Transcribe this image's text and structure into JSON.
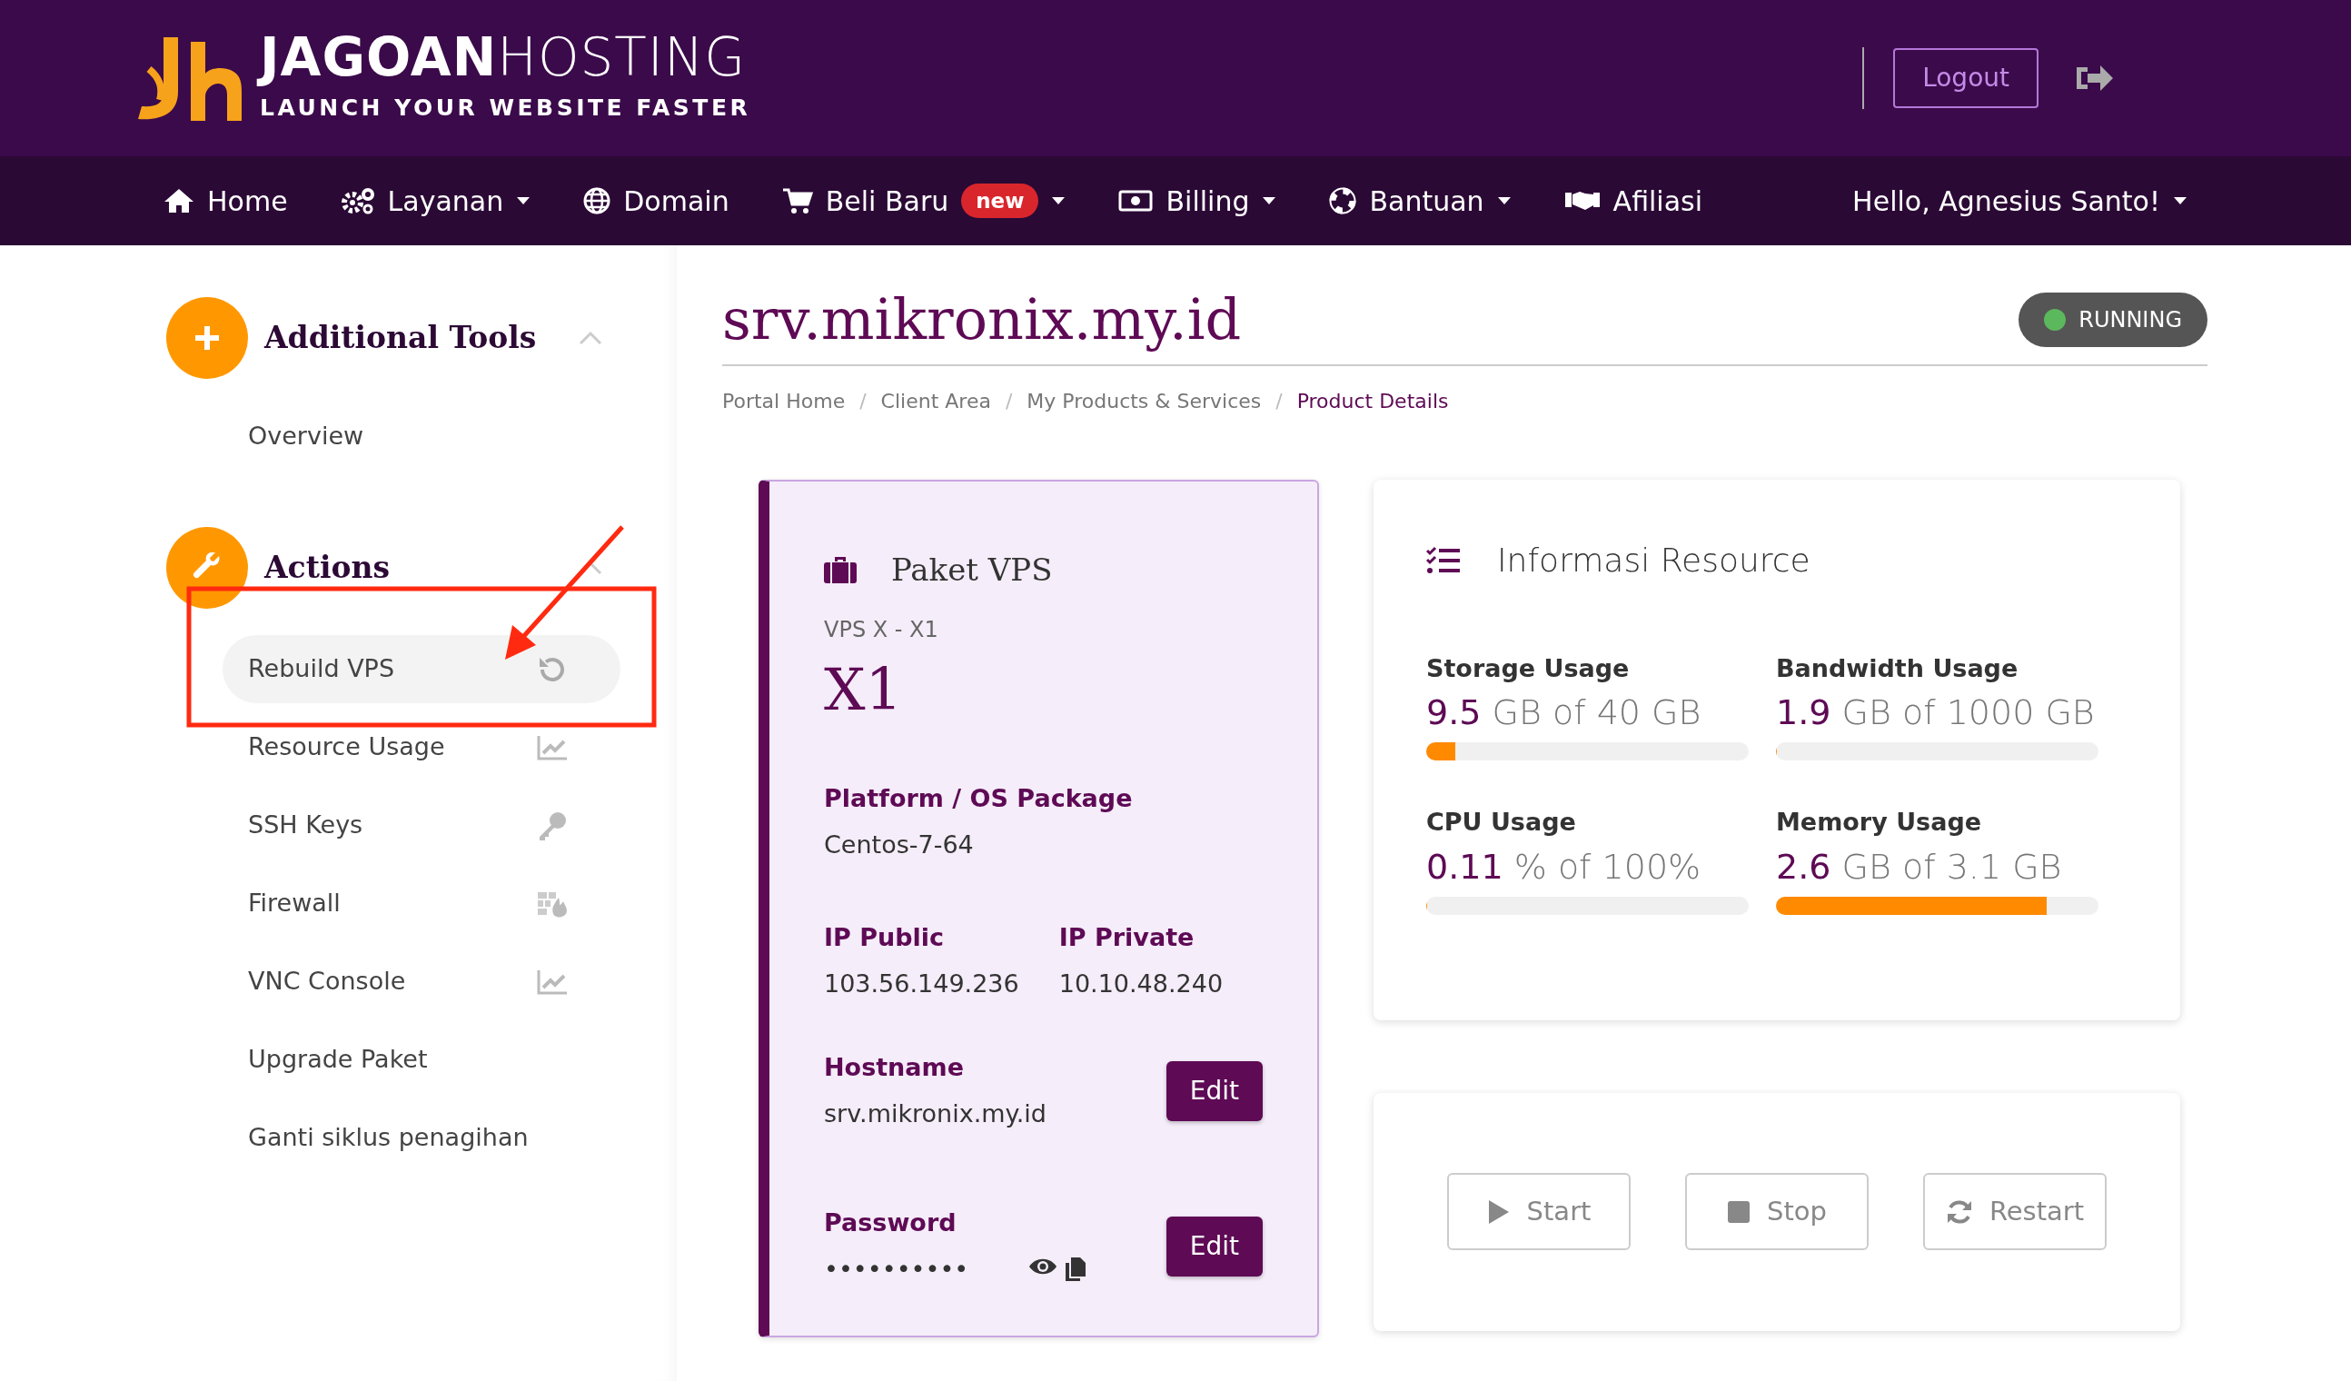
{
  "header": {
    "logo_title": "**JAGOAN**HOSTING",
    "logo_tagline": "LAUNCH YOUR WEBSITE FASTER",
    "logout_button": "Logout"
  },
  "nav": {
    "items": [
      {
        "label": "Home",
        "dropdown": false
      },
      {
        "label": "Layanan",
        "dropdown": true
      },
      {
        "label": "Domain",
        "dropdown": false
      },
      {
        "label": "Beli Baru",
        "badge": "new",
        "dropdown": true
      },
      {
        "label": "Billing",
        "dropdown": true
      },
      {
        "label": "Bantuan",
        "dropdown": true
      },
      {
        "label": "Afiliasi",
        "dropdown": false
      }
    ],
    "user_menu": {
      "label": "Hello, Agnesius Santo!",
      "dropdown": true
    }
  },
  "sidebar": {
    "sections": [
      {
        "title": "Additional Tools",
        "expanded": true,
        "items": [
          {
            "label": "Overview",
            "selected": false
          }
        ]
      },
      {
        "title": "Actions",
        "expanded": true,
        "items": [
          {
            "label": "Rebuild VPS",
            "selected": true
          },
          {
            "label": "Resource Usage",
            "selected": false
          },
          {
            "label": "SSH Keys",
            "selected": false
          },
          {
            "label": "Firewall",
            "selected": false
          },
          {
            "label": "VNC Console",
            "selected": false
          },
          {
            "label": "Upgrade Paket",
            "selected": false
          },
          {
            "label": "Ganti siklus penagihan",
            "selected": false
          }
        ]
      }
    ]
  },
  "page": {
    "title": "srv.mikronix.my.id",
    "status": {
      "label": "RUNNING",
      "color": "#5cb85c"
    }
  },
  "breadcrumb": {
    "separator": "/",
    "items": [
      {
        "label": "Portal Home",
        "selected": false
      },
      {
        "label": "Client Area",
        "selected": false
      },
      {
        "label": "My Products & Services",
        "selected": false
      },
      {
        "label": "Product Details",
        "selected": true
      }
    ]
  },
  "package_card": {
    "title": "Paket VPS",
    "subtitle": "VPS X - X1",
    "plan": "X1",
    "os": {
      "label": "Platform / OS Package",
      "value": "Centos-7-64"
    },
    "ips": [
      {
        "label": "IP Public",
        "value": "103.56.149.236"
      },
      {
        "label": "IP Private",
        "value": "10.10.48.240"
      }
    ],
    "hostname": {
      "label": "Hostname",
      "value": "srv.mikronix.my.id",
      "button": "Edit"
    },
    "password": {
      "label": "Password",
      "value": "••••••••••",
      "button": "Edit"
    }
  },
  "resources": {
    "title": "Informasi Resource",
    "items": [
      {
        "label": "Storage Usage",
        "used": "9.5",
        "total": "GB of 40 GB",
        "level": 0.09
      },
      {
        "label": "Bandwidth Usage",
        "used": "1.9",
        "total": "GB of 1000 GB",
        "level": 0.002
      },
      {
        "label": "CPU Usage",
        "used": "0.11",
        "total": "% of 100%",
        "level": 0.0011
      },
      {
        "label": "Memory Usage",
        "used": "2.6",
        "total": "GB of 3.1 GB",
        "level": 0.84
      }
    ]
  },
  "power_buttons": [
    {
      "label": "Start"
    },
    {
      "label": "Stop"
    },
    {
      "label": "Restart"
    }
  ]
}
